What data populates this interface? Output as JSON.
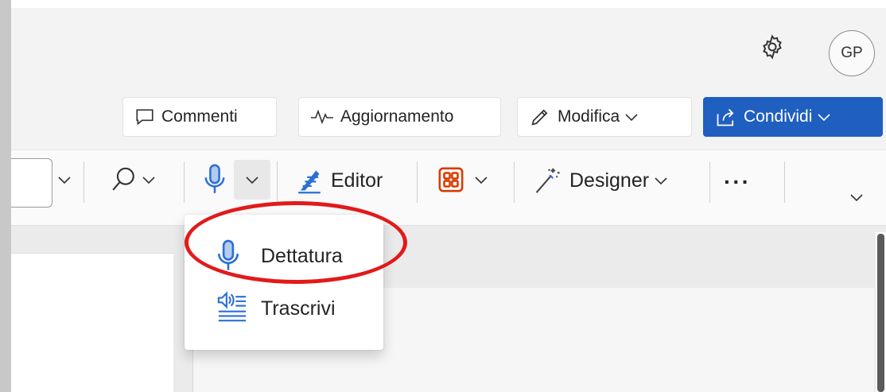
{
  "header": {
    "avatar_initials": "GP",
    "settings_icon": "gear-icon"
  },
  "actions": {
    "comments_label": "Commenti",
    "update_label": "Aggiornamento",
    "edit_label": "Modifica",
    "share_label": "Condividi"
  },
  "ribbon": {
    "editor_label": "Editor",
    "designer_label": "Designer",
    "more_label": "···"
  },
  "dictate_menu": {
    "items": [
      {
        "label": "Dettatura",
        "icon": "microphone-icon"
      },
      {
        "label": "Trascrivi",
        "icon": "transcribe-icon"
      }
    ]
  },
  "colors": {
    "share_button": "#1f5fbf",
    "icon_blue": "#2b6fd6",
    "highlight": "#e21a1a",
    "addins_icon": "#d83b01"
  }
}
